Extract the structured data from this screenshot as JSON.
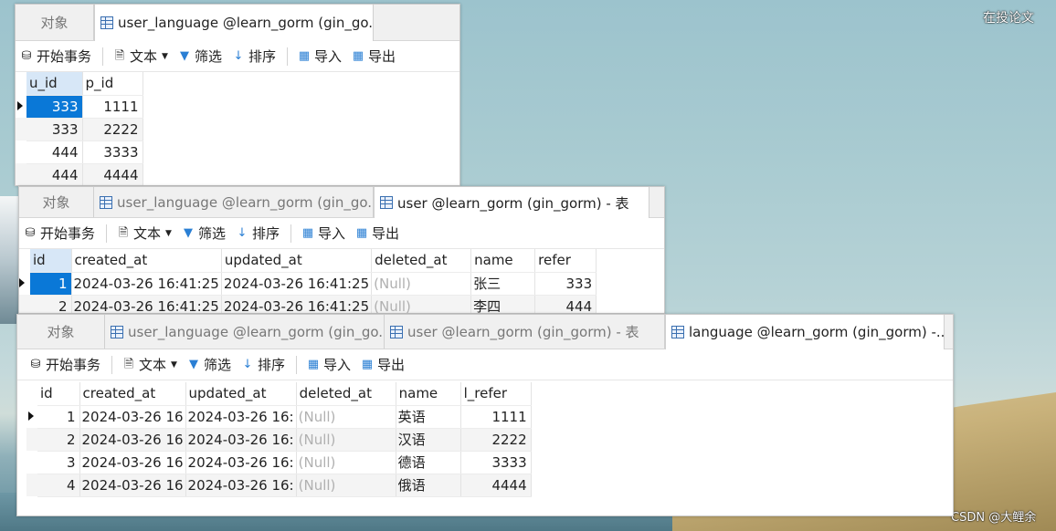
{
  "desktop": {
    "top_right_label": "在投论文",
    "watermark": "CSDN @大鲤余"
  },
  "toolbar": {
    "begin_tx": "开始事务",
    "text": "文本",
    "filter": "筛选",
    "sort": "排序",
    "import": "导入",
    "export": "导出"
  },
  "win1": {
    "tabs": [
      "对象",
      "user_language @learn_gorm (gin_go..."
    ],
    "columns": [
      "u_id",
      "p_id"
    ],
    "rows": [
      [
        "333",
        "1111"
      ],
      [
        "333",
        "2222"
      ],
      [
        "444",
        "3333"
      ],
      [
        "444",
        "4444"
      ]
    ]
  },
  "win2": {
    "tabs": [
      "对象",
      "user_language @learn_gorm (gin_go...",
      "user @learn_gorm (gin_gorm) - 表"
    ],
    "columns": [
      "id",
      "created_at",
      "updated_at",
      "deleted_at",
      "name",
      "refer"
    ],
    "rows": [
      [
        "1",
        "2024-03-26 16:41:25",
        "2024-03-26 16:41:25",
        "(Null)",
        "张三",
        "333"
      ],
      [
        "2",
        "2024-03-26 16:41:25",
        "2024-03-26 16:41:25",
        "(Null)",
        "李四",
        "444"
      ]
    ]
  },
  "win3": {
    "tabs": [
      "对象",
      "user_language @learn_gorm (gin_go...",
      "user @learn_gorm (gin_gorm) - 表",
      "language @learn_gorm (gin_gorm) -..."
    ],
    "columns": [
      "id",
      "created_at",
      "updated_at",
      "deleted_at",
      "name",
      "l_refer"
    ],
    "rows": [
      [
        "1",
        "2024-03-26 16",
        "2024-03-26 16:",
        "(Null)",
        "英语",
        "1111"
      ],
      [
        "2",
        "2024-03-26 16",
        "2024-03-26 16:",
        "(Null)",
        "汉语",
        "2222"
      ],
      [
        "3",
        "2024-03-26 16",
        "2024-03-26 16:",
        "(Null)",
        "德语",
        "3333"
      ],
      [
        "4",
        "2024-03-26 16",
        "2024-03-26 16:",
        "(Null)",
        "俄语",
        "4444"
      ]
    ]
  }
}
